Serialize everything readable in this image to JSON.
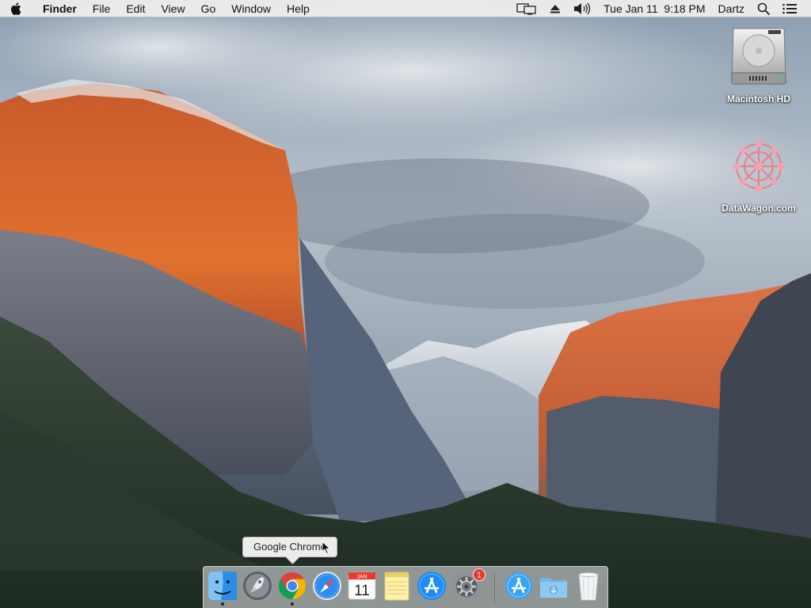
{
  "menubar": {
    "app_name": "Finder",
    "menus": [
      "File",
      "Edit",
      "View",
      "Go",
      "Window",
      "Help"
    ],
    "clock": "Tue Jan 11  9:18 PM",
    "user": "Dartz",
    "status_icons": [
      "display-mirroring-icon",
      "eject-icon",
      "volume-icon",
      "spotlight-icon",
      "notification-center-icon"
    ]
  },
  "desktop": {
    "icons": [
      {
        "label": "Macintosh HD",
        "icon": "hard-drive-icon"
      },
      {
        "label": "DataWagon.com",
        "icon": "network-share-icon"
      }
    ]
  },
  "tooltip": {
    "text": "Google Chrome"
  },
  "dock": {
    "items": [
      {
        "name": "Finder",
        "icon": "finder-icon",
        "running": true
      },
      {
        "name": "Launchpad",
        "icon": "launchpad-icon",
        "running": false
      },
      {
        "name": "Google Chrome",
        "icon": "chrome-icon",
        "running": true
      },
      {
        "name": "Safari",
        "icon": "safari-icon",
        "running": false
      },
      {
        "name": "Calendar",
        "icon": "calendar-icon",
        "running": false,
        "month": "JAN",
        "day": "11"
      },
      {
        "name": "Notes",
        "icon": "notes-icon",
        "running": false
      },
      {
        "name": "App Store",
        "icon": "app-store-icon",
        "running": false
      },
      {
        "name": "System Preferences",
        "icon": "system-preferences-icon",
        "running": false,
        "badge": "1"
      },
      {
        "name": "Applications",
        "icon": "applications-folder-icon",
        "running": false
      },
      {
        "name": "Downloads",
        "icon": "downloads-folder-icon",
        "running": false
      },
      {
        "name": "Trash",
        "icon": "trash-icon",
        "running": false
      }
    ]
  },
  "colors": {
    "menubar_bg": "#ececec",
    "badge_red": "#e8392f",
    "chrome_red": "#db4437",
    "chrome_yellow": "#f4b400",
    "chrome_green": "#0f9d58",
    "chrome_blue": "#4285f4"
  }
}
